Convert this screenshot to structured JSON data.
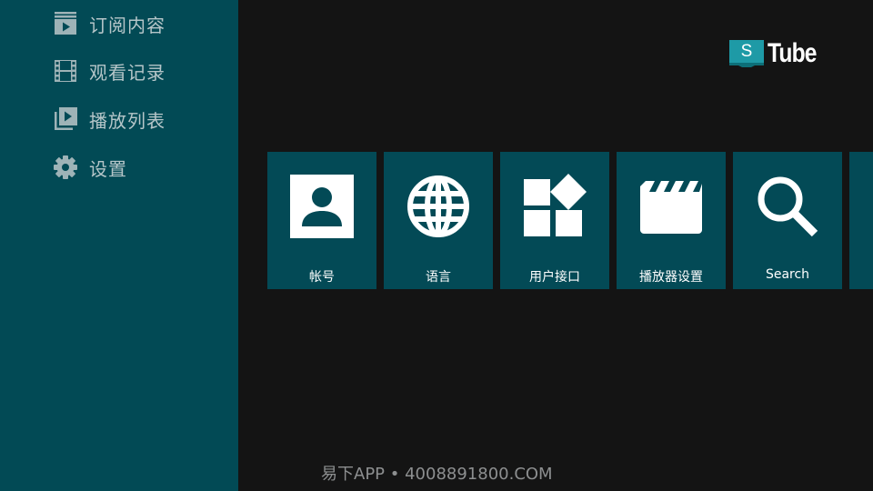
{
  "sidebar": {
    "items": [
      {
        "label": "订阅内容",
        "icon": "subscriptions-icon"
      },
      {
        "label": "观看记录",
        "icon": "history-film-icon"
      },
      {
        "label": "播放列表",
        "icon": "playlist-icon"
      },
      {
        "label": "设置",
        "icon": "gear-icon"
      }
    ]
  },
  "logo": {
    "badge_letter": "S",
    "text": "Tube"
  },
  "tiles": [
    {
      "label": "帐号",
      "icon": "account-icon"
    },
    {
      "label": "语言",
      "icon": "globe-icon"
    },
    {
      "label": "用户接口",
      "icon": "interface-widgets-icon"
    },
    {
      "label": "播放器设置",
      "icon": "clapperboard-icon"
    },
    {
      "label": "Search",
      "icon": "search-icon"
    },
    {
      "label": "",
      "icon": "partial-tile-icon"
    }
  ],
  "watermark": "易下APP • 4008891800.COM",
  "colors": {
    "sidebar_bg": "#024a55",
    "tile_bg": "#034a56",
    "page_bg": "#141414",
    "logo_accent": "#1e9aa6"
  }
}
